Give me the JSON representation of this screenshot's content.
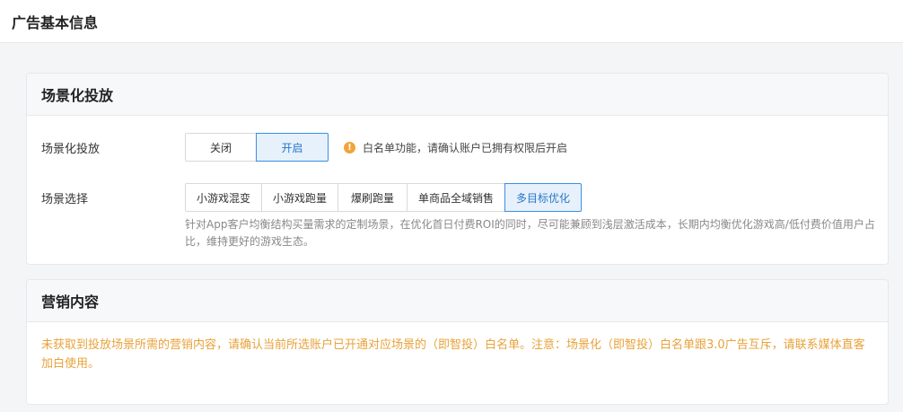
{
  "header": {
    "title": "广告基本信息"
  },
  "card_scene": {
    "title": "场景化投放",
    "delivery": {
      "label": "场景化投放",
      "options": [
        "关闭",
        "开启"
      ],
      "selected": "开启",
      "tip": "白名单功能，请确认账户已拥有权限后开启"
    },
    "scene": {
      "label": "场景选择",
      "options": [
        "小游戏混变",
        "小游戏跑量",
        "爆刷跑量",
        "单商品全域销售",
        "多目标优化"
      ],
      "selected": "多目标优化",
      "description": "针对App客户均衡结构买量需求的定制场景，在优化首日付费ROI的同时，尽可能兼顾到浅层激活成本，长期内均衡优化游戏高/低付费价值用户占比，维持更好的游戏生态。"
    }
  },
  "card_marketing": {
    "title": "营销内容",
    "warning": "未获取到投放场景所需的营销内容，请确认当前所选账户已开通对应场景的（即智投）白名单。注意：场景化（即智投）白名单跟3.0广告互斥，请联系媒体直客加白使用。"
  },
  "colors": {
    "accent": "#3a8ee6",
    "active_bg": "#e6f1fb",
    "warning": "#e8a23a",
    "tip_icon": "#f2a33a"
  }
}
